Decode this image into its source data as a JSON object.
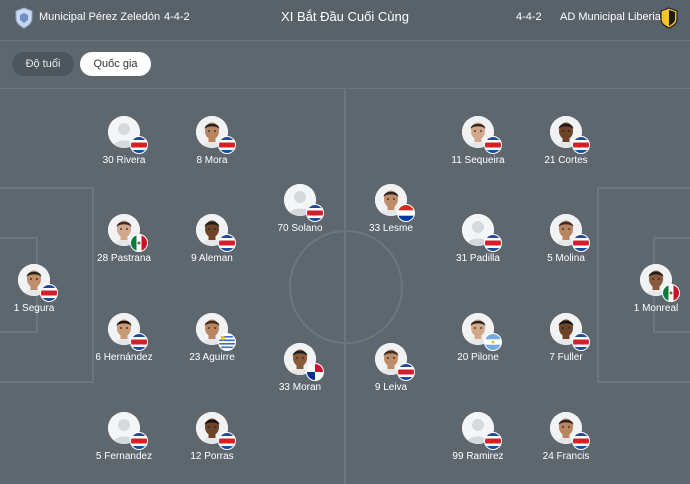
{
  "header": {
    "title": "XI Bắt Đầu Cuối Cùng",
    "home": {
      "name": "Municipal Pérez Zeledón",
      "formation": "4-4-2"
    },
    "away": {
      "name": "AD Municipal Liberia",
      "formation": "4-4-2"
    }
  },
  "tabs": [
    {
      "label": "Độ tuổi",
      "active": false
    },
    {
      "label": "Quốc gia",
      "active": true
    }
  ],
  "colors": {
    "background": "#5f676e",
    "pitch_lines": "#6e767d",
    "active_tab": "#ffffff"
  },
  "home_players": [
    {
      "label": "30 Rivera",
      "flag": "costa-rica",
      "photo": false
    },
    {
      "label": "8 Mora",
      "flag": "costa-rica",
      "photo": true
    },
    {
      "label": "70 Solano",
      "flag": "costa-rica",
      "photo": false
    },
    {
      "label": "28 Pastrana",
      "flag": "mexico",
      "photo": true
    },
    {
      "label": "9 Aleman",
      "flag": "costa-rica",
      "photo": true
    },
    {
      "label": "1 Segura",
      "flag": "costa-rica",
      "photo": true
    },
    {
      "label": "6 Hernández",
      "flag": "costa-rica",
      "photo": true
    },
    {
      "label": "23 Aguirre",
      "flag": "uruguay",
      "photo": true
    },
    {
      "label": "33 Moran",
      "flag": "panama",
      "photo": true
    },
    {
      "label": "5 Fernandez",
      "flag": "costa-rica",
      "photo": false
    },
    {
      "label": "12 Porras",
      "flag": "costa-rica",
      "photo": true
    }
  ],
  "away_players": [
    {
      "label": "11 Sequeira",
      "flag": "costa-rica",
      "photo": true
    },
    {
      "label": "21 Cortes",
      "flag": "costa-rica",
      "photo": true
    },
    {
      "label": "33 Lesme",
      "flag": "paraguay",
      "photo": true
    },
    {
      "label": "31 Padilla",
      "flag": "costa-rica",
      "photo": false
    },
    {
      "label": "5 Molina",
      "flag": "costa-rica",
      "photo": true
    },
    {
      "label": "1 Monreal",
      "flag": "mexico",
      "photo": true
    },
    {
      "label": "20 Pilone",
      "flag": "argentina",
      "photo": true
    },
    {
      "label": "7 Fuller",
      "flag": "costa-rica",
      "photo": true
    },
    {
      "label": "9 Leiva",
      "flag": "costa-rica",
      "photo": true
    },
    {
      "label": "99 Ramirez",
      "flag": "costa-rica",
      "photo": false
    },
    {
      "label": "24 Francis",
      "flag": "costa-rica",
      "photo": true
    }
  ]
}
